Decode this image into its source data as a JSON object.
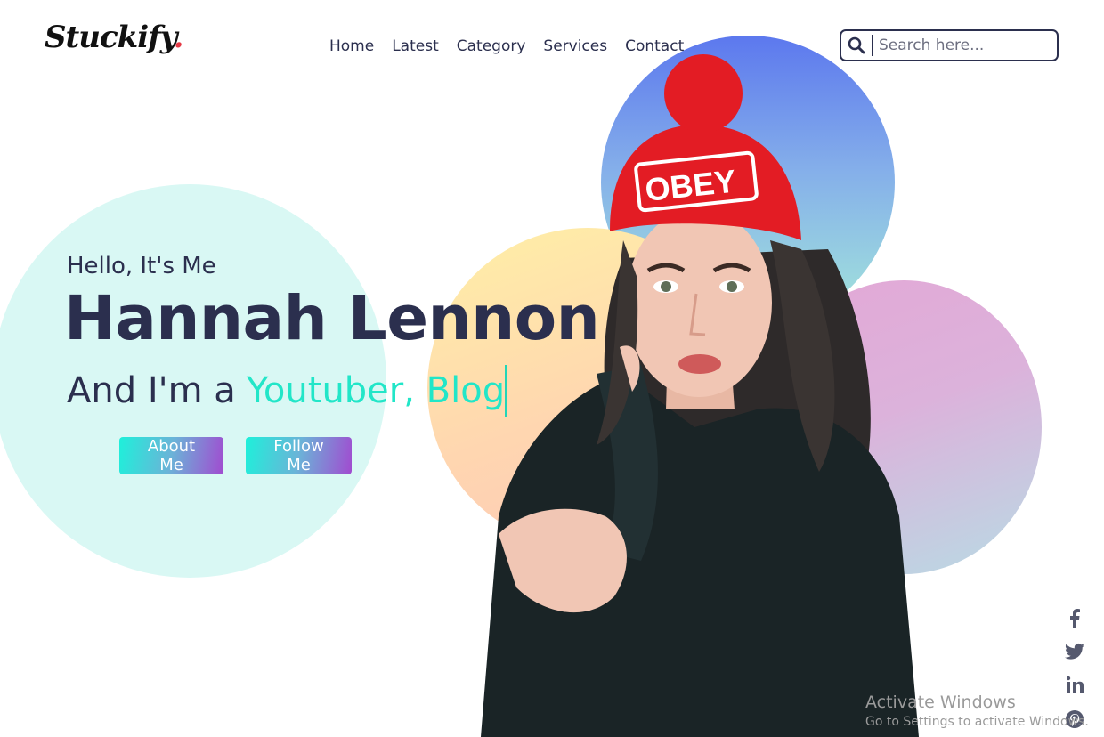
{
  "brand": {
    "logo_text": "Stuckify",
    "logo_dot": ".",
    "accent_color": "#e53945"
  },
  "nav": {
    "items": [
      {
        "label": "Home"
      },
      {
        "label": "Latest"
      },
      {
        "label": "Category"
      },
      {
        "label": "Services"
      },
      {
        "label": "Contact"
      }
    ]
  },
  "search": {
    "placeholder": "Search here...",
    "value": "",
    "icon": "search-icon"
  },
  "hero": {
    "greeting": "Hello, It's Me",
    "name": "Hannah Lennon",
    "role_prefix": "And I'm a",
    "role_typed": "Youtuber, Blog",
    "role_typed_color": "#22e6c8"
  },
  "buttons": {
    "about_label": "About Me",
    "follow_label": "Follow Me"
  },
  "social": [
    "facebook-icon",
    "twitter-icon",
    "linkedin-icon",
    "pinterest-icon"
  ],
  "system_watermark": {
    "title": "Activate Windows",
    "subtitle": "Go to Settings to activate Windows."
  },
  "colors": {
    "text_dark": "#2b2f4e",
    "mint_circle": "#d9f8f4",
    "button_gradient_start": "#1ef0da",
    "button_gradient_end": "#a14bd0"
  }
}
